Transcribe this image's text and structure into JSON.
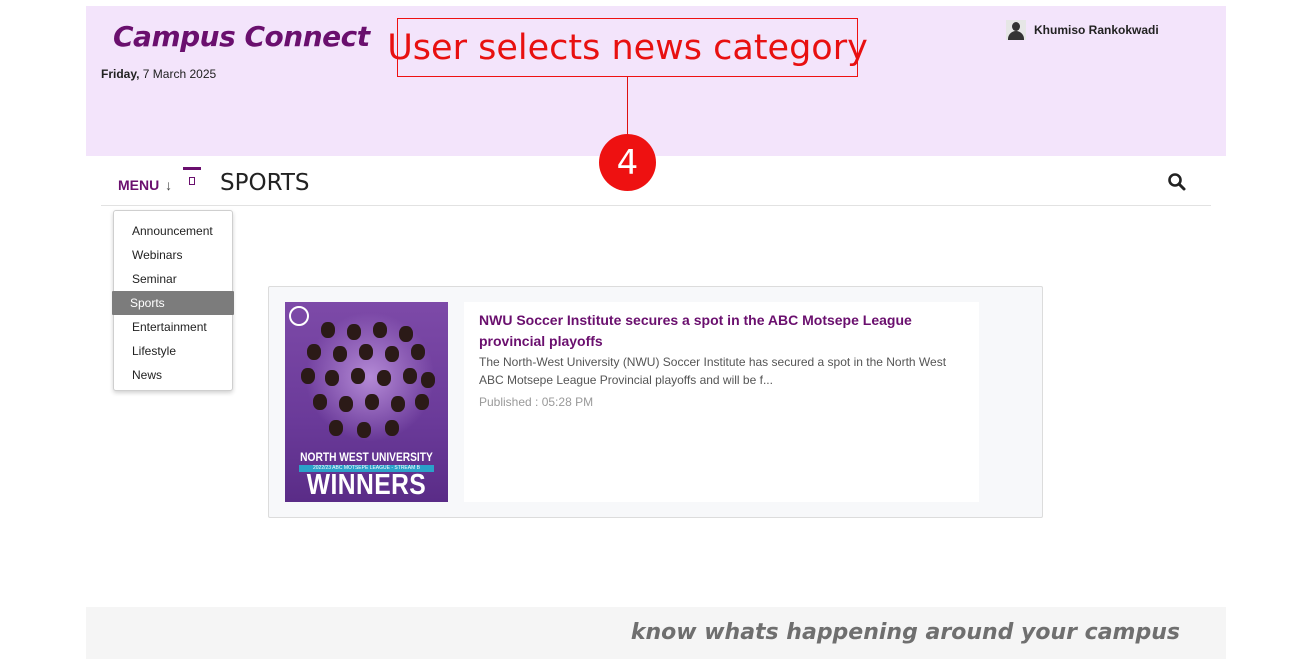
{
  "header": {
    "brand": "Campus Connect",
    "date_day": "Friday,",
    "date_rest": " 7 March 2025",
    "user_name": "Khumiso Rankokwadi"
  },
  "annotation": {
    "label": "User selects news category",
    "step": "4"
  },
  "nav": {
    "menu_label": "MENU",
    "menu_arrow": "↓",
    "section_title": "SPORTS"
  },
  "dropdown": {
    "items": [
      "Announcement",
      "Webinars",
      "Seminar",
      "Sports",
      "Entertainment",
      "Lifestyle",
      "News"
    ],
    "selected": "Sports"
  },
  "article": {
    "title": "NWU Soccer Institute secures a spot in the ABC Motsepe League provincial playoffs",
    "excerpt": "The North-West University (NWU) Soccer Institute has secured a spot in the North West ABC Motsepe League Provincial playoffs and will be f...",
    "published": "Published : 05:28 PM",
    "image": {
      "line1": "NORTH WEST UNIVERSITY",
      "line2": "2022/23 ABC MOTSEPE LEAGUE - STREAM B",
      "line3": "WINNERS"
    }
  },
  "footer": {
    "tagline": "know whats happening around your campus"
  },
  "colors": {
    "brand": "#6a0f6e",
    "header_bg": "#f3e4fb",
    "annotation": "#ee1111",
    "selected_item_bg": "#7c7c7c"
  }
}
